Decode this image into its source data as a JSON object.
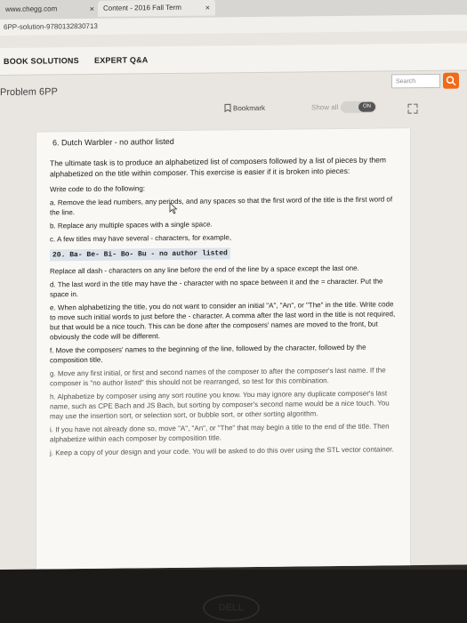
{
  "browser": {
    "tab1_label": "www.chegg.com",
    "tab2_label": "Content - 2016 Fall Term",
    "url": "6PP-solution-9780132830713"
  },
  "nav": {
    "book_solutions": "BOOK SOLUTIONS",
    "expert_qa": "EXPERT Q&A",
    "search_placeholder": "Search"
  },
  "problem": {
    "title": "Problem 6PP",
    "bookmark": "Bookmark",
    "show_all_steps": "Show all steps:",
    "toggle_state": "ON"
  },
  "question": {
    "heading": "6. Dutch Warbler - no author listed",
    "intro": "The ultimate task is to produce an alphabetized list of composers followed by a list of pieces by them alphabetized on the title within composer. This exercise is easier if it is broken into pieces:",
    "write_code": "Write code to do the following:",
    "a": "a. Remove the lead numbers, any periods, and any spaces so that the first word of the title is the first word of the line.",
    "b": "b. Replace any multiple spaces with a single space.",
    "c": "c. A few titles may have several - characters, for example,",
    "c_code": "20. Ba- Be- Bi- Bo- Bu - no author listed",
    "c_2": "Replace all dash - characters on any line before the end of the line by a space except the last one.",
    "d": "d. The last word in the title may have the - character with no space between it and the = character. Put the space in.",
    "e": "e. When alphabetizing the title, you do not want to consider an initial \"A\", \"An\", or \"The\" in the title. Write code to move such initial words to just before the - character. A comma after the last word in the title is not required, but that would be a nice touch. This can be done after the composers' names are moved to the front, but obviously the code will be different.",
    "f": "f. Move the composers' names to the beginning of the line, followed by the character, followed by the composition title.",
    "g": "g. Move any first initial, or first and second names of the composer to after the composer's last name. If the composer is \"no author listed\" this should not be rearranged, so test for this combination.",
    "h": "h. Alphabetize by composer using any sort routine you know. You may ignore any duplicate composer's last name, such as CPE Bach and JS Bach, but sorting by composer's second name would be a nice touch. You may use the insertion sort, or selection sort, or bubble sort, or other sorting algorithm.",
    "i": "i. If you have not already done so, move \"A\", \"An\", or \"The\" that may begin a title to the end of the title. Then alphabetize within each composer by composition title.",
    "j": "j. Keep a copy of your design and your code. You will be asked to do this over using the STL vector container."
  },
  "monitor": {
    "brand": "DELL"
  }
}
